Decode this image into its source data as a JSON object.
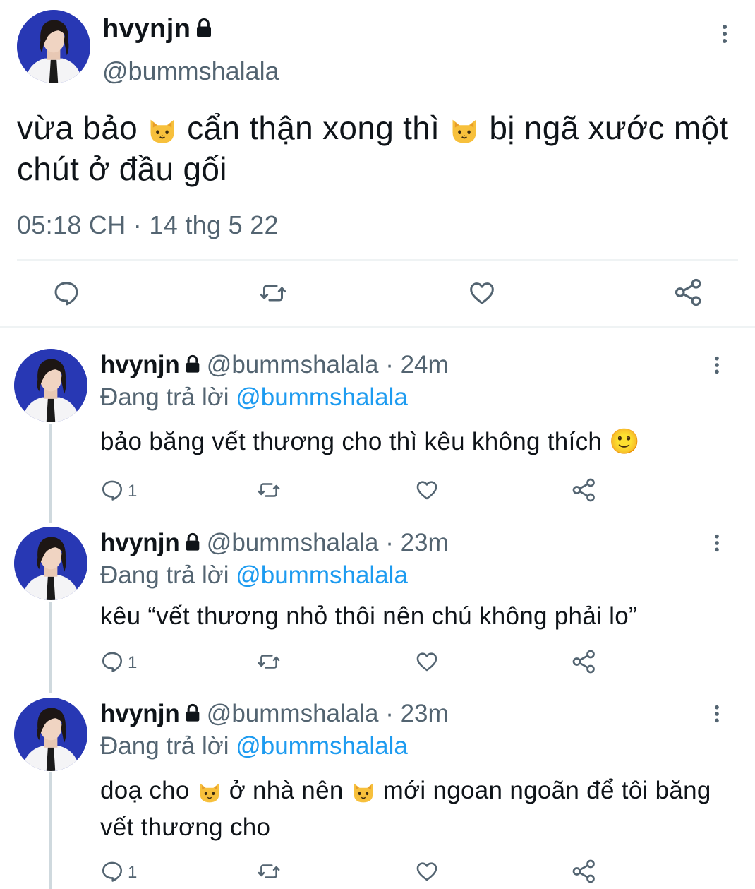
{
  "main_tweet": {
    "display_name": "hvynjn",
    "handle": "@bummshalala",
    "text_parts": [
      "vừa bảo ",
      " cẩn thận xong thì ",
      " bị ngã xước một chút ở đầu gối"
    ],
    "timestamp": "05:18 CH · 14 thg 5 22",
    "icons": [
      "reply-icon",
      "retweet-icon",
      "like-icon",
      "share-icon"
    ]
  },
  "replies": [
    {
      "display_name": "hvynjn",
      "handle_time": "@bummshalala · 24m",
      "replying_prefix": "Đang trả lời ",
      "replying_mention": "@bummshalala",
      "text": "bảo băng vết thương cho thì kêu không thích 🙂",
      "reply_count": "1"
    },
    {
      "display_name": "hvynjn",
      "handle_time": "@bummshalala · 23m",
      "replying_prefix": "Đang trả lời ",
      "replying_mention": "@bummshalala",
      "text": "kêu “vết thương nhỏ thôi nên chú không phải lo”",
      "reply_count": "1"
    },
    {
      "display_name": "hvynjn",
      "handle_time": "@bummshalala · 23m",
      "replying_prefix": "Đang trả lời ",
      "replying_mention": "@bummshalala",
      "text_parts": [
        "doạ cho ",
        " ở nhà nên ",
        " mới ngoan ngoãn để tôi băng vết thương cho"
      ],
      "reply_count": "1"
    }
  ],
  "colors": {
    "secondary": "#536471",
    "link": "#1d9bf0",
    "divider": "#eff3f4",
    "thread_line": "#cfd9de"
  }
}
